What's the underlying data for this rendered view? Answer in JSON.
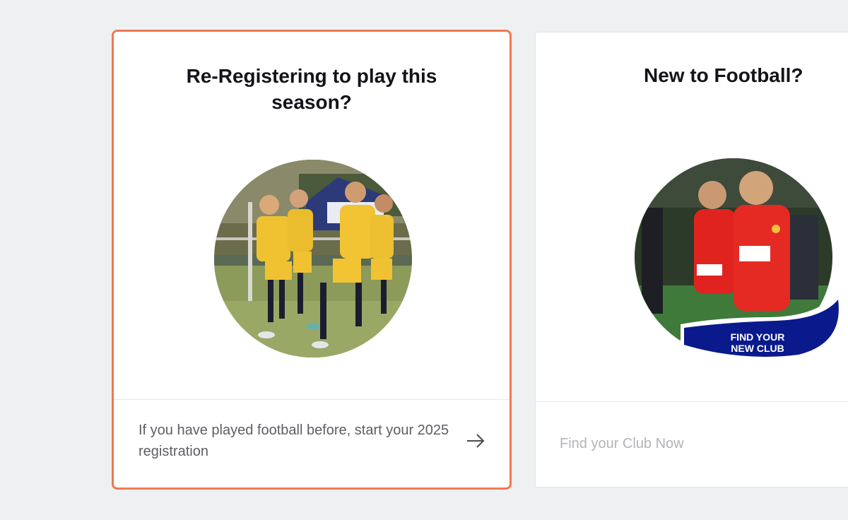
{
  "cards": [
    {
      "title": "Re-Registering to play this season?",
      "image_alt": "Junior girls football team celebrating",
      "footer_text": "If you have played football before, start your 2025 registration",
      "arrow_icon": "arrow-right-icon"
    },
    {
      "title": "New to Football?",
      "image_alt": "Adult footballers in red kit celebrating",
      "banner_line1": "FIND YOUR",
      "banner_line2": "NEW CLUB",
      "footer_text": "Find your Club Now"
    }
  ],
  "colors": {
    "page_bg": "#eff0f2",
    "selected_border": "#ee7a52",
    "banner_blue": "#0a1a8c",
    "kit_red": "#e0231e",
    "kit_yellow": "#f2c230"
  }
}
